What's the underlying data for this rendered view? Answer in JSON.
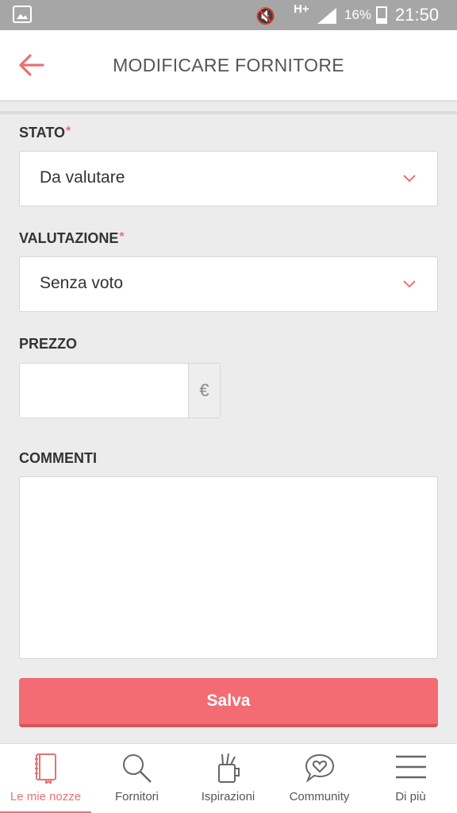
{
  "status_bar": {
    "network": "H+",
    "battery": "16%",
    "time": "21:50"
  },
  "header": {
    "title": "MODIFICARE FORNITORE",
    "back_icon": "arrow-left-icon"
  },
  "form": {
    "stato": {
      "label": "STATO",
      "required_mark": "*",
      "value": "Da valutare"
    },
    "valutazione": {
      "label": "VALUTAZIONE",
      "required_mark": "*",
      "value": "Senza voto"
    },
    "prezzo": {
      "label": "PREZZO",
      "value": "",
      "currency": "€"
    },
    "commenti": {
      "label": "COMMENTI",
      "value": ""
    },
    "save_label": "Salva"
  },
  "bottom_nav": {
    "items": [
      {
        "label": "Le mie nozze",
        "icon": "notebook-icon",
        "active": true
      },
      {
        "label": "Fornitori",
        "icon": "search-icon",
        "active": false
      },
      {
        "label": "Ispirazioni",
        "icon": "pencil-cup-icon",
        "active": false
      },
      {
        "label": "Community",
        "icon": "chat-heart-icon",
        "active": false
      },
      {
        "label": "Di più",
        "icon": "menu-icon",
        "active": false
      }
    ]
  },
  "colors": {
    "accent": "#f36b73",
    "label_accent": "#e57373",
    "status_bar": "#a6a6a6"
  }
}
